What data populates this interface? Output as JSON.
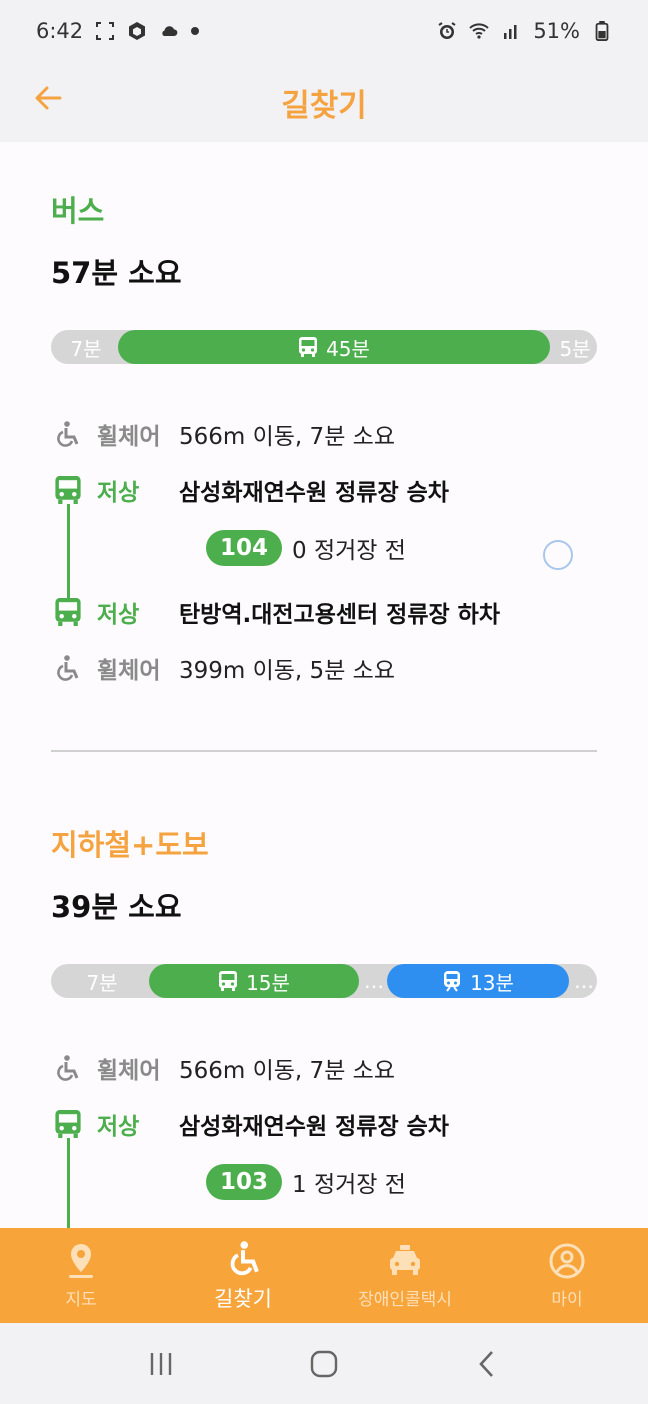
{
  "status_bar": {
    "time": "6:42",
    "battery": "51%"
  },
  "header": {
    "title": "길찾기"
  },
  "routes": [
    {
      "type": "버스",
      "total": "57분 소요",
      "bar": {
        "left": "7분",
        "main": "45분",
        "right": "5분"
      },
      "steps": {
        "walk1_label": "휠체어",
        "walk1_text": "566m 이동,  7분 소요",
        "board_label": "저상",
        "board_text": "삼성화재연수원 정류장 승차",
        "bus_number": "104",
        "bus_stops": "0 정거장 전",
        "alight_label": "저상",
        "alight_text": "탄방역.대전고용센터 정류장 하차",
        "walk2_label": "휠체어",
        "walk2_text": "399m 이동,  5분 소요"
      }
    },
    {
      "type": "지하철+도보",
      "total": "39분 소요",
      "bar": {
        "left": "7분",
        "bus": "15분",
        "gap1": "…",
        "subway": "13분",
        "gap2": "…"
      },
      "steps": {
        "walk1_label": "휠체어",
        "walk1_text": "566m 이동,  7분 소요",
        "board_label": "저상",
        "board_text": "삼성화재연수원 정류장 승차",
        "bus_number": "103",
        "bus_stops": "1 정거장 전"
      }
    }
  ],
  "bottom_nav": [
    {
      "label": "지도"
    },
    {
      "label": "길찾기"
    },
    {
      "label": "장애인콜택시"
    },
    {
      "label": "마이"
    }
  ],
  "colors": {
    "accent": "#f5a340",
    "bus_green": "#4cae4c",
    "subway_blue": "#2f8ff0",
    "nav_bg": "#f7a43b"
  }
}
